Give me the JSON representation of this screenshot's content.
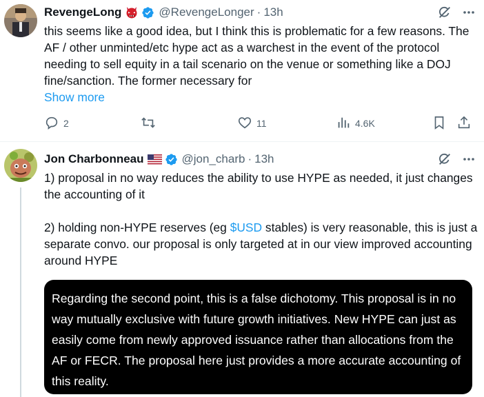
{
  "tweets": [
    {
      "name": "RevengeLong",
      "handle": "@RevengeLonger",
      "separator": "·",
      "time": "13h",
      "text": "this seems like a good idea, but I think this is problematic for a few reasons. The AF / other unminted/etc hype act as a warchest in the event of the protocol needing to sell equity in a tail scenario on the venue or something like a DOJ fine/sanction. The former necessary for",
      "show_more": "Show more",
      "replies": "2",
      "reposts": "",
      "likes": "11",
      "views": "4.6K"
    },
    {
      "name": "Jon Charbonneau",
      "handle": "@jon_charb",
      "separator": "·",
      "time": "13h",
      "text_p1": "1) proposal in no way reduces the ability to use HYPE as needed, it just changes the accounting of it",
      "text_p2_before": "2) holding non-HYPE reserves (eg ",
      "text_p2_link": "$USD",
      "text_p2_after": " stables) is very reasonable, this is just a separate convo. our proposal is only targeted at in our view improved accounting around HYPE",
      "image_text": "Regarding the second point, this is a false dichotomy. This proposal is in no way mutually exclusive with future growth initiatives. New HYPE can just as easily come from newly approved issuance rather than allocations from the AF or FECR. The proposal here just provides a more accurate accounting of this reality."
    }
  ],
  "colors": {
    "text": "#0f1419",
    "secondary": "#536471",
    "accent": "#1d9bf0",
    "verified": "#1d9bf0"
  }
}
